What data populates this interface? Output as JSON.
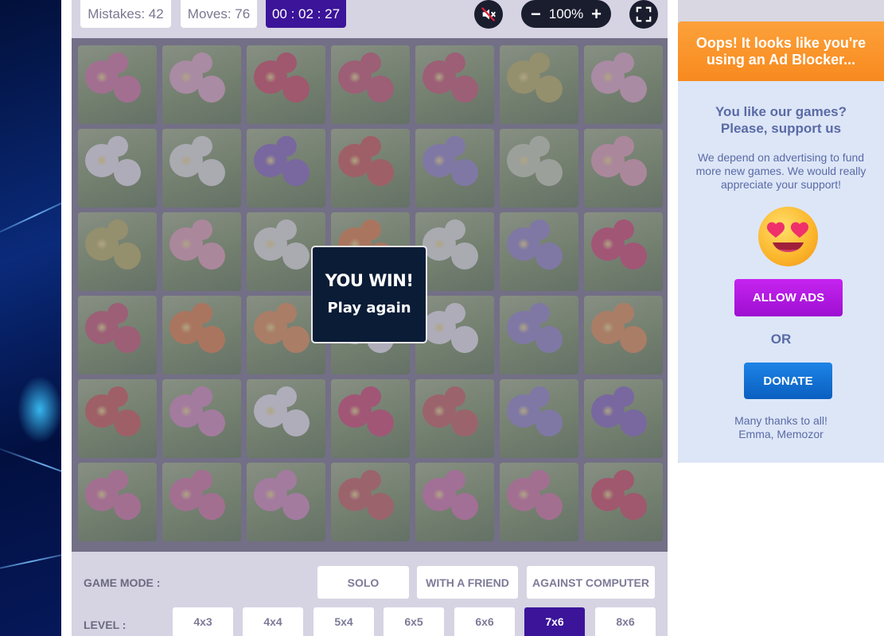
{
  "stats": {
    "mistakes": "Mistakes: 42",
    "moves": "Moves: 76",
    "timer": "00 : 02 : 27"
  },
  "zoom": {
    "minus": "−",
    "value": "100%",
    "plus": "+"
  },
  "icons": {
    "sound": "muted-speaker-icon",
    "fullscreen": "fullscreen-icon"
  },
  "win": {
    "title": "YOU WIN!",
    "play_again": "Play again"
  },
  "settings": {
    "mode_label": "GAME MODE :",
    "modes": [
      {
        "label": "SOLO",
        "active": true
      },
      {
        "label": "WITH A FRIEND",
        "active": false
      },
      {
        "label": "AGAINST COMPUTER",
        "active": false
      }
    ],
    "level_label": "LEVEL :",
    "levels": [
      {
        "label": "4x3",
        "active": false
      },
      {
        "label": "4x4",
        "active": false
      },
      {
        "label": "5x4",
        "active": false
      },
      {
        "label": "6x5",
        "active": false
      },
      {
        "label": "6x6",
        "active": false
      },
      {
        "label": "7x6",
        "active": true
      },
      {
        "label": "8x6",
        "active": false
      }
    ]
  },
  "ad": {
    "header": "Oops! It looks like you're using an Ad Blocker...",
    "subtitle_line1": "You like our games?",
    "subtitle_line2": "Please, support us",
    "text": "We depend on advertising to fund more new games. We would really appreciate your support!",
    "emoji": "heart-eyes-emoji-icon",
    "allow_label": "ALLOW ADS",
    "or_label": "OR",
    "donate_label": "DONATE",
    "thanks_line1": "Many thanks to all!",
    "thanks_line2": "Emma, Memozor"
  },
  "board": {
    "cols": 7,
    "rows": 6,
    "cards": [
      "pink-geranium",
      "cosmos-field",
      "red-geranium",
      "red-ginger",
      "red-ginger",
      "yellow-orchid",
      "cosmos-field",
      "daisies",
      "white-snowdrops",
      "purple-pansy",
      "red-poppies",
      "passion-flower",
      "green-snowdrops",
      "pink-camellia",
      "yellow-orchid",
      "pink-camellia",
      "white-snowdrops",
      "bird-of-paradise",
      "white-snowdrops",
      "passion-flower",
      "bleeding-heart",
      "red-ginger",
      "bird-of-paradise",
      "orange-flowers",
      "white-lily",
      "daisies",
      "passion-flower",
      "orange-flowers",
      "red-poppies",
      "pink-magnolia",
      "white-lily",
      "bleeding-heart",
      "red-zinnia",
      "passion-flower",
      "purple-pansy",
      "pink-geranium",
      "pink-geranium",
      "pink-magnolia",
      "red-zinnia",
      "pink-dahlia",
      "pink-geranium",
      "red-geranium"
    ],
    "colors": {
      "pink-geranium": "#d86a9a",
      "cosmos-field": "#e6a8c0",
      "red-geranium": "#d0384a",
      "red-ginger": "#c9485e",
      "yellow-orchid": "#b9b24a",
      "daisies": "#f2f2f2",
      "white-snowdrops": "#e8ede0",
      "purple-pansy": "#7a5bb8",
      "red-poppies": "#cf4a3a",
      "passion-flower": "#8b7fc4",
      "green-snowdrops": "#c9d7b0",
      "pink-camellia": "#eaa0b0",
      "bird-of-paradise": "#e8782a",
      "bleeding-heart": "#d6345e",
      "orange-flowers": "#e88a3a",
      "white-lily": "#f4f4f4",
      "pink-magnolia": "#d985b8",
      "red-zinnia": "#c8524a",
      "pink-dahlia": "#d86aa4"
    }
  }
}
